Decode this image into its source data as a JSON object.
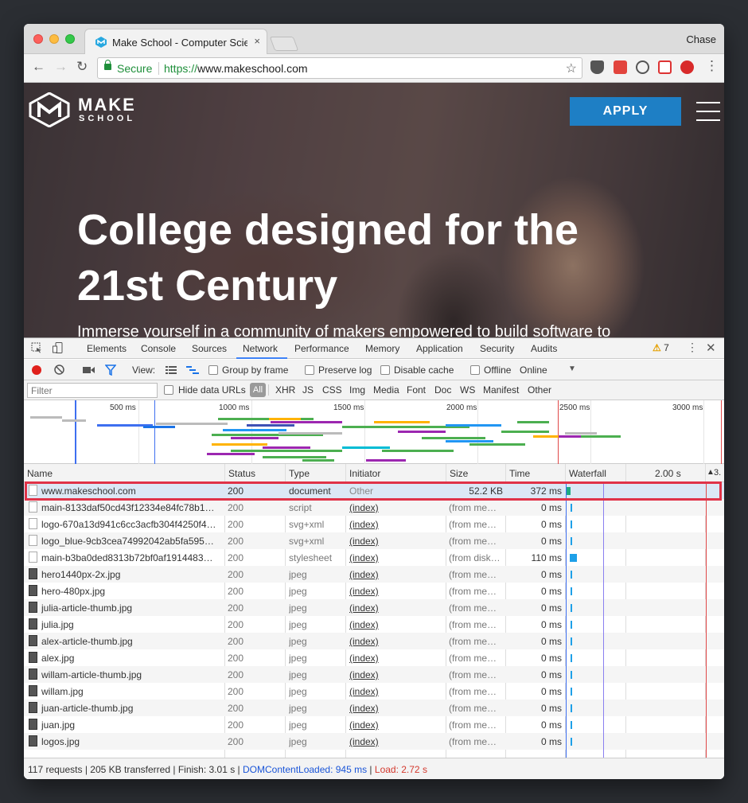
{
  "browser": {
    "tab_title": "Make School - Computer Scien",
    "tab_close": "×",
    "profile": "Chase",
    "secure_label": "Secure",
    "url_scheme": "https://",
    "url_rest": "www.makeschool.com"
  },
  "page": {
    "logo_make": "MAKE",
    "logo_school": "SCHOOL",
    "apply_label": "APPLY",
    "hero_title": "College designed for the 21st Century",
    "hero_subtitle": "Immerse yourself in a community of makers empowered to build software to"
  },
  "devtools": {
    "tabs": [
      "Elements",
      "Console",
      "Sources",
      "Network",
      "Performance",
      "Memory",
      "Application",
      "Security",
      "Audits"
    ],
    "active_tab": "Network",
    "warnings": "7",
    "controls": {
      "view_label": "View:",
      "group_by_frame": "Group by frame",
      "preserve_log": "Preserve log",
      "disable_cache": "Disable cache",
      "offline": "Offline",
      "throttle": "Online"
    },
    "filter": {
      "placeholder": "Filter",
      "hide_data_urls": "Hide data URLs",
      "types": [
        "All",
        "XHR",
        "JS",
        "CSS",
        "Img",
        "Media",
        "Font",
        "Doc",
        "WS",
        "Manifest",
        "Other"
      ]
    },
    "overview_ticks": [
      "500 ms",
      "1000 ms",
      "1500 ms",
      "2000 ms",
      "2500 ms",
      "3000 ms"
    ],
    "columns": {
      "name": "Name",
      "status": "Status",
      "type": "Type",
      "initiator": "Initiator",
      "size": "Size",
      "time": "Time",
      "waterfall": "Waterfall",
      "wf_tick": "2.00 s",
      "wf_tick_right": "3."
    },
    "requests": [
      {
        "name": "www.makeschool.com",
        "status": "200",
        "type": "document",
        "initiator": "Other",
        "size": "52.2 KB",
        "time": "372 ms",
        "selected": true
      },
      {
        "name": "main-8133daf50cd43f12334e84fc78b1…",
        "status": "200",
        "type": "script",
        "initiator": "(index)",
        "size": "(from me…",
        "time": "0 ms"
      },
      {
        "name": "logo-670a13d941c6cc3acfb304f4250f4…",
        "status": "200",
        "type": "svg+xml",
        "initiator": "(index)",
        "size": "(from me…",
        "time": "0 ms"
      },
      {
        "name": "logo_blue-9cb3cea74992042ab5fa595…",
        "status": "200",
        "type": "svg+xml",
        "initiator": "(index)",
        "size": "(from me…",
        "time": "0 ms"
      },
      {
        "name": "main-b3ba0ded8313b72bf0af1914483…",
        "status": "200",
        "type": "stylesheet",
        "initiator": "(index)",
        "size": "(from disk…",
        "time": "110 ms"
      },
      {
        "name": "hero1440px-2x.jpg",
        "status": "200",
        "type": "jpeg",
        "initiator": "(index)",
        "size": "(from me…",
        "time": "0 ms"
      },
      {
        "name": "hero-480px.jpg",
        "status": "200",
        "type": "jpeg",
        "initiator": "(index)",
        "size": "(from me…",
        "time": "0 ms"
      },
      {
        "name": "julia-article-thumb.jpg",
        "status": "200",
        "type": "jpeg",
        "initiator": "(index)",
        "size": "(from me…",
        "time": "0 ms"
      },
      {
        "name": "julia.jpg",
        "status": "200",
        "type": "jpeg",
        "initiator": "(index)",
        "size": "(from me…",
        "time": "0 ms"
      },
      {
        "name": "alex-article-thumb.jpg",
        "status": "200",
        "type": "jpeg",
        "initiator": "(index)",
        "size": "(from me…",
        "time": "0 ms"
      },
      {
        "name": "alex.jpg",
        "status": "200",
        "type": "jpeg",
        "initiator": "(index)",
        "size": "(from me…",
        "time": "0 ms"
      },
      {
        "name": "willam-article-thumb.jpg",
        "status": "200",
        "type": "jpeg",
        "initiator": "(index)",
        "size": "(from me…",
        "time": "0 ms"
      },
      {
        "name": "willam.jpg",
        "status": "200",
        "type": "jpeg",
        "initiator": "(index)",
        "size": "(from me…",
        "time": "0 ms"
      },
      {
        "name": "juan-article-thumb.jpg",
        "status": "200",
        "type": "jpeg",
        "initiator": "(index)",
        "size": "(from me…",
        "time": "0 ms"
      },
      {
        "name": "juan.jpg",
        "status": "200",
        "type": "jpeg",
        "initiator": "(index)",
        "size": "(from me…",
        "time": "0 ms"
      },
      {
        "name": "logos.jpg",
        "status": "200",
        "type": "jpeg",
        "initiator": "(index)",
        "size": "(from me…",
        "time": "0 ms"
      }
    ],
    "summary": {
      "requests": "117 requests",
      "transferred": "205 KB transferred",
      "finish": "Finish: 3.01 s",
      "dom_content_loaded": "DOMContentLoaded: 945 ms",
      "load": "Load: 2.72 s"
    },
    "colors": {
      "accent": "#3e82f7",
      "dcl_line": "#1a55d8",
      "load_line": "#d43a2f",
      "highlight": "#e03348"
    }
  }
}
